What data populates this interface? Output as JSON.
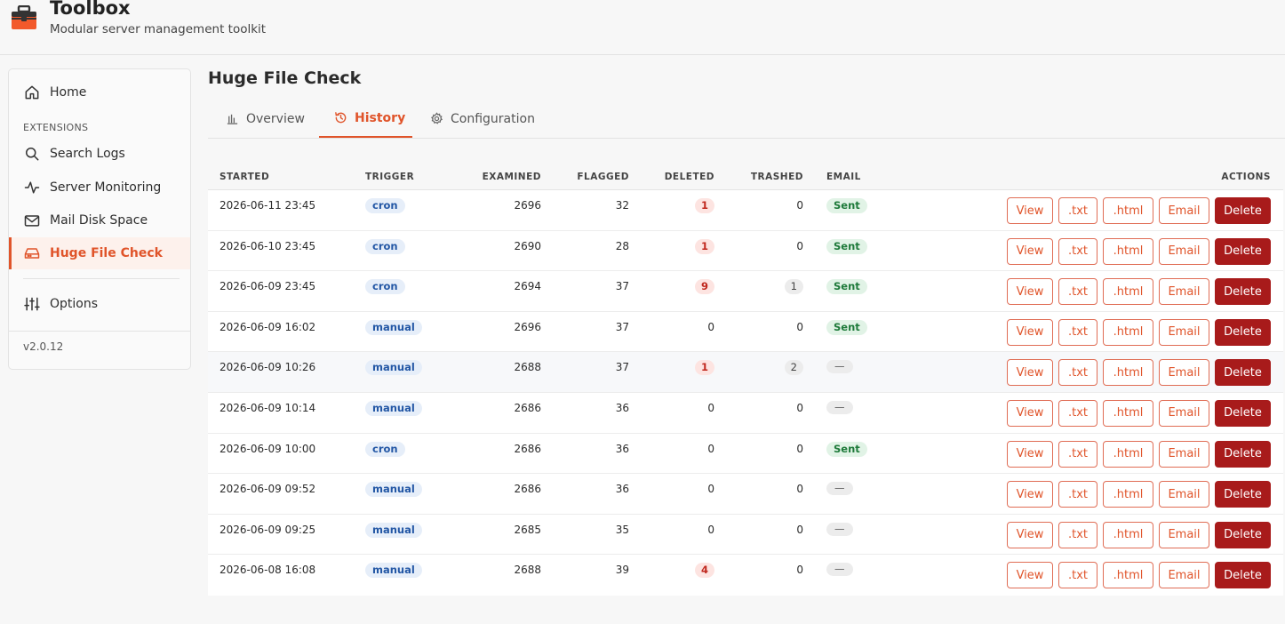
{
  "app": {
    "title": "Toolbox",
    "subtitle": "Modular server management toolkit"
  },
  "sidebar": {
    "home": "Home",
    "section_label": "EXTENSIONS",
    "items": [
      {
        "label": "Search Logs",
        "icon": "search-icon"
      },
      {
        "label": "Server Monitoring",
        "icon": "activity-icon"
      },
      {
        "label": "Mail Disk Space",
        "icon": "mail-icon"
      },
      {
        "label": "Huge File Check",
        "icon": "hard-drive-icon",
        "active": true
      }
    ],
    "options": "Options",
    "version": "v2.0.12"
  },
  "page": {
    "title": "Huge File Check",
    "tabs": [
      {
        "label": "Overview",
        "icon": "bar-chart-icon"
      },
      {
        "label": "History",
        "icon": "history-icon",
        "active": true
      },
      {
        "label": "Configuration",
        "icon": "gear-icon"
      }
    ]
  },
  "table": {
    "headers": {
      "started": "STARTED",
      "trigger": "TRIGGER",
      "examined": "EXAMINED",
      "flagged": "FLAGGED",
      "deleted": "DELETED",
      "trashed": "TRASHED",
      "email": "EMAIL",
      "actions": "ACTIONS"
    },
    "action_labels": {
      "view": "View",
      "txt": ".txt",
      "html": ".html",
      "email": "Email",
      "delete": "Delete"
    },
    "rows": [
      {
        "started": "2026-06-11 23:45",
        "trigger": "cron",
        "examined": "2696",
        "flagged": "32",
        "deleted": "1",
        "trashed": "0",
        "email": "Sent"
      },
      {
        "started": "2026-06-10 23:45",
        "trigger": "cron",
        "examined": "2690",
        "flagged": "28",
        "deleted": "1",
        "trashed": "0",
        "email": "Sent"
      },
      {
        "started": "2026-06-09 23:45",
        "trigger": "cron",
        "examined": "2694",
        "flagged": "37",
        "deleted": "9",
        "trashed": "1",
        "email": "Sent"
      },
      {
        "started": "2026-06-09 16:02",
        "trigger": "manual",
        "examined": "2696",
        "flagged": "37",
        "deleted": "0",
        "trashed": "0",
        "email": "Sent"
      },
      {
        "started": "2026-06-09 10:26",
        "trigger": "manual",
        "examined": "2688",
        "flagged": "37",
        "deleted": "1",
        "trashed": "2",
        "email": "—"
      },
      {
        "started": "2026-06-09 10:14",
        "trigger": "manual",
        "examined": "2686",
        "flagged": "36",
        "deleted": "0",
        "trashed": "0",
        "email": "—"
      },
      {
        "started": "2026-06-09 10:00",
        "trigger": "cron",
        "examined": "2686",
        "flagged": "36",
        "deleted": "0",
        "trashed": "0",
        "email": "Sent"
      },
      {
        "started": "2026-06-09 09:52",
        "trigger": "manual",
        "examined": "2686",
        "flagged": "36",
        "deleted": "0",
        "trashed": "0",
        "email": "—"
      },
      {
        "started": "2026-06-09 09:25",
        "trigger": "manual",
        "examined": "2685",
        "flagged": "35",
        "deleted": "0",
        "trashed": "0",
        "email": "—"
      },
      {
        "started": "2026-06-08 16:08",
        "trigger": "manual",
        "examined": "2688",
        "flagged": "39",
        "deleted": "4",
        "trashed": "0",
        "email": "—"
      }
    ]
  },
  "colors": {
    "accent": "#e0542a",
    "danger": "#a81b1b",
    "trigger_bg": "#e6eef9",
    "sent_bg": "#e1f3e6",
    "deleted_bg": "#fde4e1"
  }
}
